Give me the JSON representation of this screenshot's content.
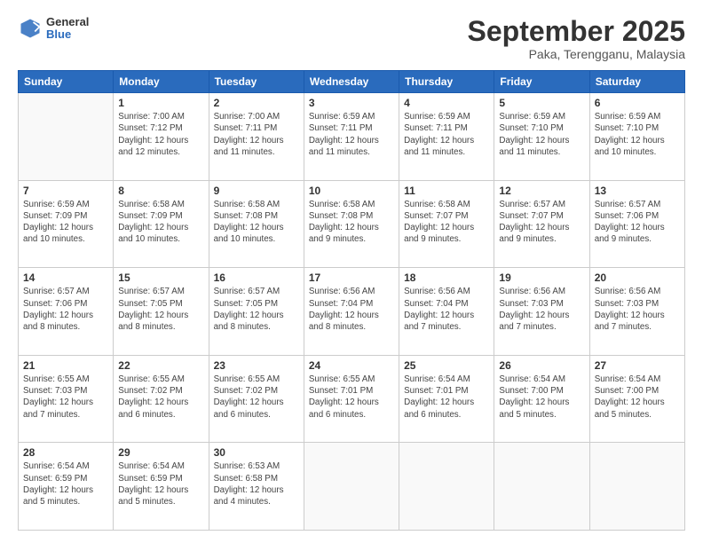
{
  "header": {
    "logo_general": "General",
    "logo_blue": "Blue",
    "month_title": "September 2025",
    "subtitle": "Paka, Terengganu, Malaysia"
  },
  "weekdays": [
    "Sunday",
    "Monday",
    "Tuesday",
    "Wednesday",
    "Thursday",
    "Friday",
    "Saturday"
  ],
  "weeks": [
    [
      {
        "day": "",
        "sunrise": "",
        "sunset": "",
        "daylight": ""
      },
      {
        "day": "1",
        "sunrise": "Sunrise: 7:00 AM",
        "sunset": "Sunset: 7:12 PM",
        "daylight": "Daylight: 12 hours and 12 minutes."
      },
      {
        "day": "2",
        "sunrise": "Sunrise: 7:00 AM",
        "sunset": "Sunset: 7:11 PM",
        "daylight": "Daylight: 12 hours and 11 minutes."
      },
      {
        "day": "3",
        "sunrise": "Sunrise: 6:59 AM",
        "sunset": "Sunset: 7:11 PM",
        "daylight": "Daylight: 12 hours and 11 minutes."
      },
      {
        "day": "4",
        "sunrise": "Sunrise: 6:59 AM",
        "sunset": "Sunset: 7:11 PM",
        "daylight": "Daylight: 12 hours and 11 minutes."
      },
      {
        "day": "5",
        "sunrise": "Sunrise: 6:59 AM",
        "sunset": "Sunset: 7:10 PM",
        "daylight": "Daylight: 12 hours and 11 minutes."
      },
      {
        "day": "6",
        "sunrise": "Sunrise: 6:59 AM",
        "sunset": "Sunset: 7:10 PM",
        "daylight": "Daylight: 12 hours and 10 minutes."
      }
    ],
    [
      {
        "day": "7",
        "sunrise": "Sunrise: 6:59 AM",
        "sunset": "Sunset: 7:09 PM",
        "daylight": "Daylight: 12 hours and 10 minutes."
      },
      {
        "day": "8",
        "sunrise": "Sunrise: 6:58 AM",
        "sunset": "Sunset: 7:09 PM",
        "daylight": "Daylight: 12 hours and 10 minutes."
      },
      {
        "day": "9",
        "sunrise": "Sunrise: 6:58 AM",
        "sunset": "Sunset: 7:08 PM",
        "daylight": "Daylight: 12 hours and 10 minutes."
      },
      {
        "day": "10",
        "sunrise": "Sunrise: 6:58 AM",
        "sunset": "Sunset: 7:08 PM",
        "daylight": "Daylight: 12 hours and 9 minutes."
      },
      {
        "day": "11",
        "sunrise": "Sunrise: 6:58 AM",
        "sunset": "Sunset: 7:07 PM",
        "daylight": "Daylight: 12 hours and 9 minutes."
      },
      {
        "day": "12",
        "sunrise": "Sunrise: 6:57 AM",
        "sunset": "Sunset: 7:07 PM",
        "daylight": "Daylight: 12 hours and 9 minutes."
      },
      {
        "day": "13",
        "sunrise": "Sunrise: 6:57 AM",
        "sunset": "Sunset: 7:06 PM",
        "daylight": "Daylight: 12 hours and 9 minutes."
      }
    ],
    [
      {
        "day": "14",
        "sunrise": "Sunrise: 6:57 AM",
        "sunset": "Sunset: 7:06 PM",
        "daylight": "Daylight: 12 hours and 8 minutes."
      },
      {
        "day": "15",
        "sunrise": "Sunrise: 6:57 AM",
        "sunset": "Sunset: 7:05 PM",
        "daylight": "Daylight: 12 hours and 8 minutes."
      },
      {
        "day": "16",
        "sunrise": "Sunrise: 6:57 AM",
        "sunset": "Sunset: 7:05 PM",
        "daylight": "Daylight: 12 hours and 8 minutes."
      },
      {
        "day": "17",
        "sunrise": "Sunrise: 6:56 AM",
        "sunset": "Sunset: 7:04 PM",
        "daylight": "Daylight: 12 hours and 8 minutes."
      },
      {
        "day": "18",
        "sunrise": "Sunrise: 6:56 AM",
        "sunset": "Sunset: 7:04 PM",
        "daylight": "Daylight: 12 hours and 7 minutes."
      },
      {
        "day": "19",
        "sunrise": "Sunrise: 6:56 AM",
        "sunset": "Sunset: 7:03 PM",
        "daylight": "Daylight: 12 hours and 7 minutes."
      },
      {
        "day": "20",
        "sunrise": "Sunrise: 6:56 AM",
        "sunset": "Sunset: 7:03 PM",
        "daylight": "Daylight: 12 hours and 7 minutes."
      }
    ],
    [
      {
        "day": "21",
        "sunrise": "Sunrise: 6:55 AM",
        "sunset": "Sunset: 7:03 PM",
        "daylight": "Daylight: 12 hours and 7 minutes."
      },
      {
        "day": "22",
        "sunrise": "Sunrise: 6:55 AM",
        "sunset": "Sunset: 7:02 PM",
        "daylight": "Daylight: 12 hours and 6 minutes."
      },
      {
        "day": "23",
        "sunrise": "Sunrise: 6:55 AM",
        "sunset": "Sunset: 7:02 PM",
        "daylight": "Daylight: 12 hours and 6 minutes."
      },
      {
        "day": "24",
        "sunrise": "Sunrise: 6:55 AM",
        "sunset": "Sunset: 7:01 PM",
        "daylight": "Daylight: 12 hours and 6 minutes."
      },
      {
        "day": "25",
        "sunrise": "Sunrise: 6:54 AM",
        "sunset": "Sunset: 7:01 PM",
        "daylight": "Daylight: 12 hours and 6 minutes."
      },
      {
        "day": "26",
        "sunrise": "Sunrise: 6:54 AM",
        "sunset": "Sunset: 7:00 PM",
        "daylight": "Daylight: 12 hours and 5 minutes."
      },
      {
        "day": "27",
        "sunrise": "Sunrise: 6:54 AM",
        "sunset": "Sunset: 7:00 PM",
        "daylight": "Daylight: 12 hours and 5 minutes."
      }
    ],
    [
      {
        "day": "28",
        "sunrise": "Sunrise: 6:54 AM",
        "sunset": "Sunset: 6:59 PM",
        "daylight": "Daylight: 12 hours and 5 minutes."
      },
      {
        "day": "29",
        "sunrise": "Sunrise: 6:54 AM",
        "sunset": "Sunset: 6:59 PM",
        "daylight": "Daylight: 12 hours and 5 minutes."
      },
      {
        "day": "30",
        "sunrise": "Sunrise: 6:53 AM",
        "sunset": "Sunset: 6:58 PM",
        "daylight": "Daylight: 12 hours and 4 minutes."
      },
      {
        "day": "",
        "sunrise": "",
        "sunset": "",
        "daylight": ""
      },
      {
        "day": "",
        "sunrise": "",
        "sunset": "",
        "daylight": ""
      },
      {
        "day": "",
        "sunrise": "",
        "sunset": "",
        "daylight": ""
      },
      {
        "day": "",
        "sunrise": "",
        "sunset": "",
        "daylight": ""
      }
    ]
  ]
}
